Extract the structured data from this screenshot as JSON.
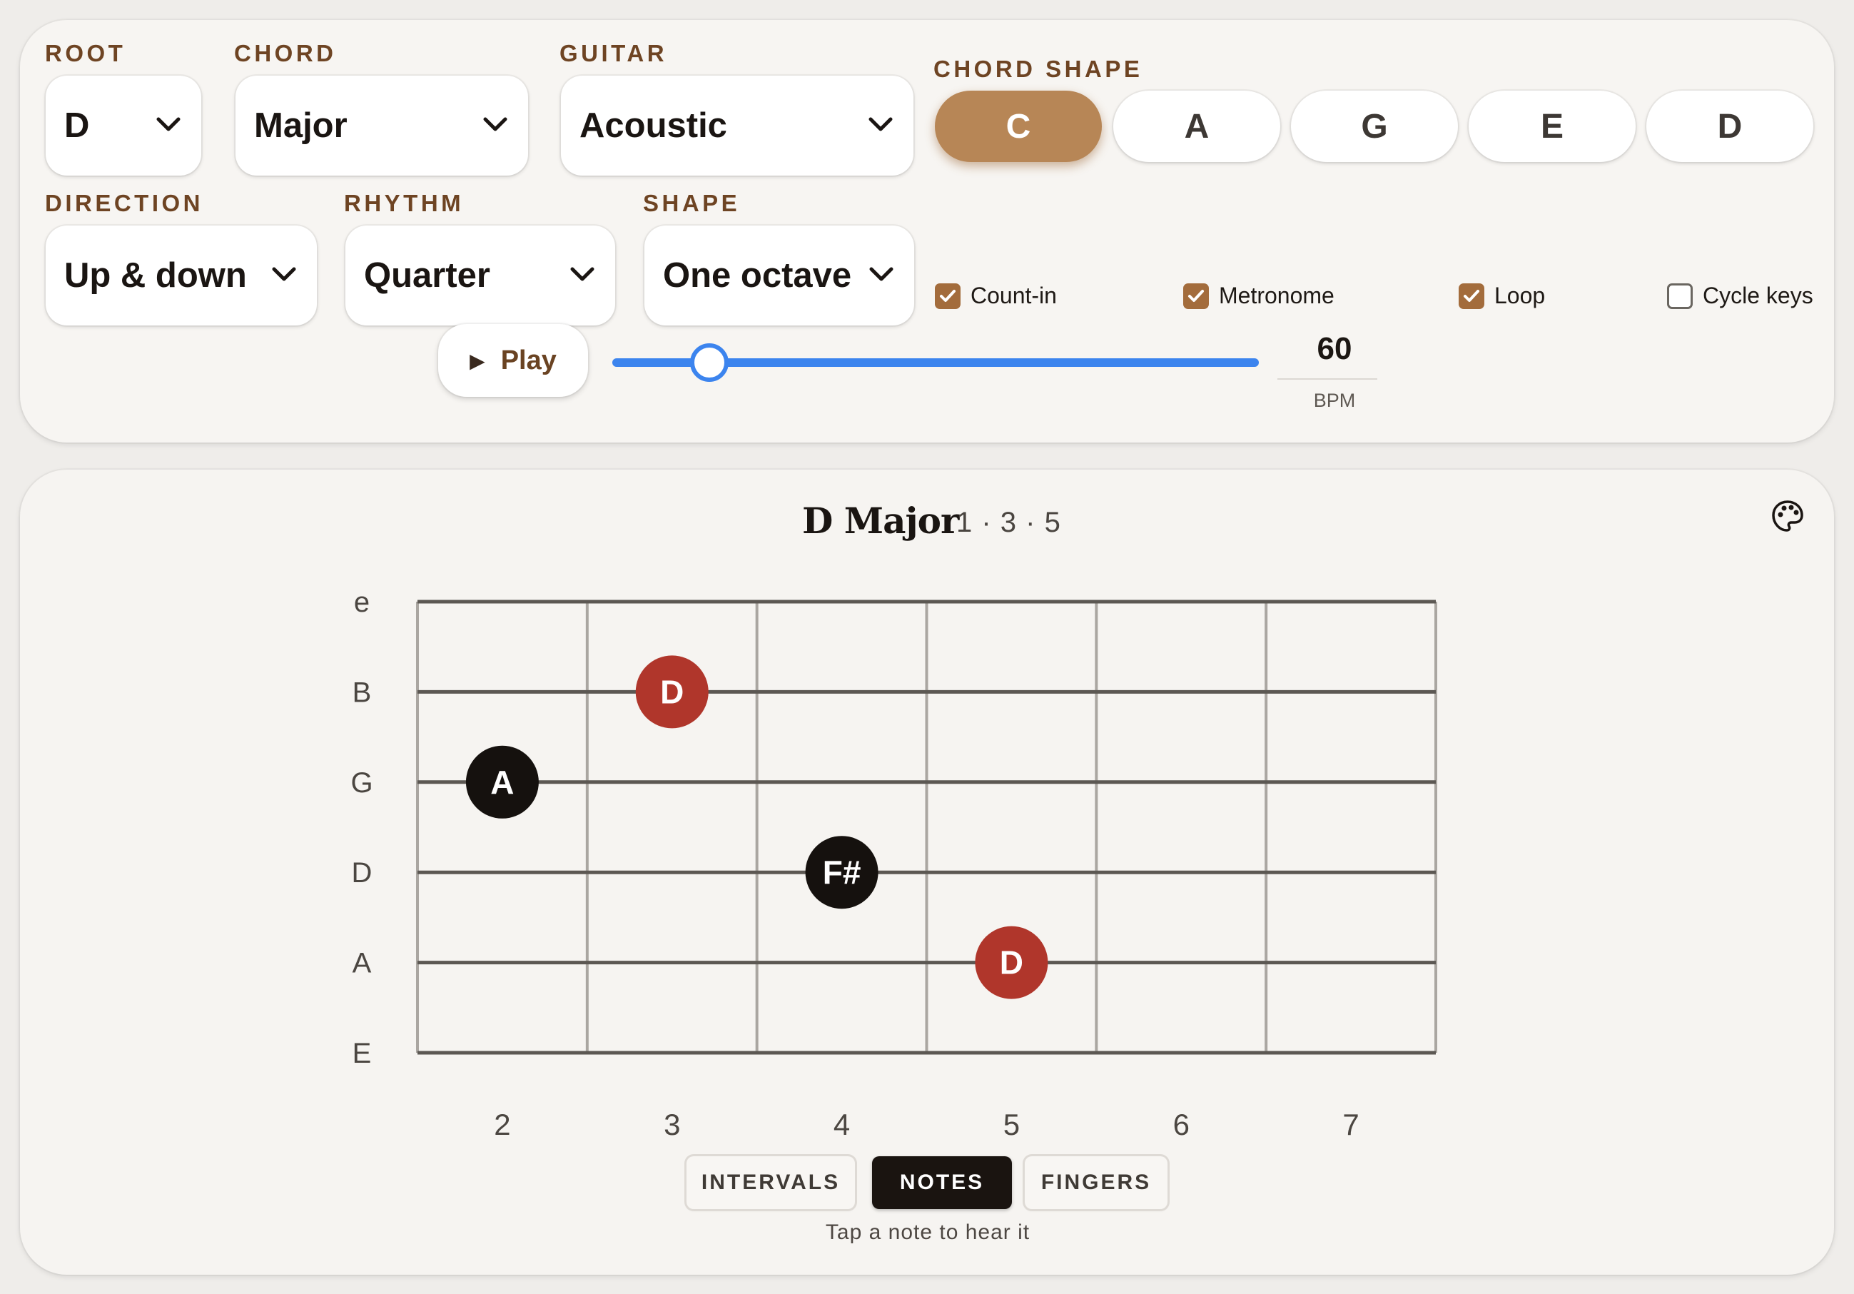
{
  "controls": {
    "root": {
      "label": "ROOT",
      "value": "D"
    },
    "chord": {
      "label": "CHORD",
      "value": "Major"
    },
    "guitar": {
      "label": "GUITAR",
      "value": "Acoustic"
    },
    "chord_shape": {
      "label": "CHORD SHAPE",
      "options": [
        "C",
        "A",
        "G",
        "E",
        "D"
      ],
      "selected": "C"
    },
    "direction": {
      "label": "DIRECTION",
      "value": "Up & down"
    },
    "rhythm": {
      "label": "RHYTHM",
      "value": "Quarter"
    },
    "shape": {
      "label": "SHAPE",
      "value": "One octave"
    },
    "checkboxes": [
      {
        "label": "Count-in",
        "checked": true
      },
      {
        "label": "Metronome",
        "checked": true
      },
      {
        "label": "Loop",
        "checked": true
      },
      {
        "label": "Cycle keys",
        "checked": false
      }
    ],
    "play_label": "Play",
    "tempo": {
      "value": "60",
      "unit": "BPM",
      "slider_fraction": 0.15
    }
  },
  "viewer": {
    "title": "D Major",
    "formula": "1 · 3 · 5",
    "strings": [
      "e",
      "B",
      "G",
      "D",
      "A",
      "E"
    ],
    "frets": [
      "2",
      "3",
      "4",
      "5",
      "6",
      "7"
    ],
    "notes": [
      {
        "string": "B",
        "fret": 3,
        "label": "D",
        "role": "root"
      },
      {
        "string": "G",
        "fret": 2,
        "label": "A",
        "role": "chord-tone"
      },
      {
        "string": "D",
        "fret": 4,
        "label": "F#",
        "role": "chord-tone"
      },
      {
        "string": "A",
        "fret": 5,
        "label": "D",
        "role": "root"
      }
    ],
    "modes": [
      "INTERVALS",
      "NOTES",
      "FINGERS"
    ],
    "active_mode": "NOTES",
    "hint": "Tap a note to hear it"
  },
  "colors": {
    "accent": "#b78656",
    "checkbox": "#a36c3c",
    "label": "#6e4423",
    "root_note": "#b0362b",
    "chord_note": "#15110e",
    "slider": "#3c84ee"
  }
}
